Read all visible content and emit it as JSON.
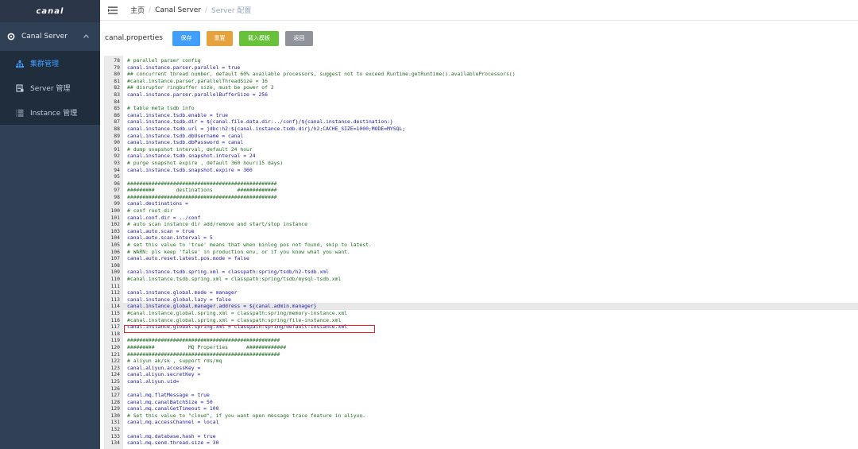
{
  "app": {
    "logo_text": "canal"
  },
  "sidebar": {
    "parent": {
      "label": "Canal Server",
      "icon": "gear-icon"
    },
    "items": [
      {
        "label": "集群管理",
        "icon": "cluster-icon",
        "active": true
      },
      {
        "label": "Server 管理",
        "icon": "server-icon",
        "active": false
      },
      {
        "label": "Instance 管理",
        "icon": "list-icon",
        "active": false
      }
    ]
  },
  "header": {
    "breadcrumb": [
      {
        "label": "主页"
      },
      {
        "label": "Canal Server"
      },
      {
        "label": "Server 配置"
      }
    ]
  },
  "toolbar": {
    "file_name": "canal.properties",
    "save_label": "保存",
    "reset_label": "重置",
    "load_template_label": "载入模板",
    "back_label": "返回"
  },
  "colors": {
    "sidebar_bg": "#304156",
    "primary": "#409eff",
    "warning": "#e6a23c",
    "success": "#67c23a",
    "info": "#909399",
    "highlight_border": "#ee2222"
  },
  "editor": {
    "highlighted_line": 117,
    "active_line": 114,
    "lines": [
      {
        "n": "78",
        "t": "# parallel parser config",
        "c": true
      },
      {
        "n": "79",
        "t": "canal.instance.parser.parallel = true",
        "c": false
      },
      {
        "n": "80",
        "t": "## concurrent thread number, default 60% available processors, suggest not to exceed Runtime.getRuntime().availableProcessors()",
        "c": true
      },
      {
        "n": "81",
        "t": "#canal.instance.parser.parallelThreadSize = 16",
        "c": true
      },
      {
        "n": "82",
        "t": "## disruptor ringbuffer size, must be power of 2",
        "c": true
      },
      {
        "n": "83",
        "t": "canal.instance.parser.parallelBufferSize = 256",
        "c": false
      },
      {
        "n": "84",
        "t": "",
        "c": false
      },
      {
        "n": "85",
        "t": "# table meta tsdb info",
        "c": true
      },
      {
        "n": "86",
        "t": "canal.instance.tsdb.enable = true",
        "c": false
      },
      {
        "n": "87",
        "t": "canal.instance.tsdb.dir = ${canal.file.data.dir:../conf}/${canal.instance.destination:}",
        "c": false
      },
      {
        "n": "88",
        "t": "canal.instance.tsdb.url = jdbc:h2:${canal.instance.tsdb.dir}/h2;CACHE_SIZE=1000;MODE=MYSQL;",
        "c": false
      },
      {
        "n": "89",
        "t": "canal.instance.tsdb.dbUsername = canal",
        "c": false
      },
      {
        "n": "90",
        "t": "canal.instance.tsdb.dbPassword = canal",
        "c": false
      },
      {
        "n": "91",
        "t": "# dump snapshot interval, default 24 hour",
        "c": true
      },
      {
        "n": "92",
        "t": "canal.instance.tsdb.snapshot.interval = 24",
        "c": false
      },
      {
        "n": "93",
        "t": "# purge snapshot expire , default 360 hour(15 days)",
        "c": true
      },
      {
        "n": "94",
        "t": "canal.instance.tsdb.snapshot.expire = 360",
        "c": false
      },
      {
        "n": "95",
        "t": "",
        "c": false
      },
      {
        "n": "96",
        "t": "#################################################",
        "c": true
      },
      {
        "n": "97",
        "t": "#########       destinations        #############",
        "c": true
      },
      {
        "n": "98",
        "t": "#################################################",
        "c": true
      },
      {
        "n": "99",
        "t": "canal.destinations =",
        "c": false
      },
      {
        "n": "100",
        "t": "# conf root dir",
        "c": true
      },
      {
        "n": "101",
        "t": "canal.conf.dir = ../conf",
        "c": false
      },
      {
        "n": "102",
        "t": "# auto scan instance dir add/remove and start/stop instance",
        "c": true
      },
      {
        "n": "103",
        "t": "canal.auto.scan = true",
        "c": false
      },
      {
        "n": "104",
        "t": "canal.auto.scan.interval = 5",
        "c": false
      },
      {
        "n": "105",
        "t": "# set this value to 'true' means that when binlog pos not found, skip to latest.",
        "c": true
      },
      {
        "n": "106",
        "t": "# WARN: pls keep 'false' in production env, or if you know what you want.",
        "c": true
      },
      {
        "n": "107",
        "t": "canal.auto.reset.latest.pos.mode = false",
        "c": false
      },
      {
        "n": "108",
        "t": "",
        "c": false
      },
      {
        "n": "109",
        "t": "canal.instance.tsdb.spring.xml = classpath:spring/tsdb/h2-tsdb.xml",
        "c": false
      },
      {
        "n": "110",
        "t": "#canal.instance.tsdb.spring.xml = classpath:spring/tsdb/mysql-tsdb.xml",
        "c": true
      },
      {
        "n": "111",
        "t": "",
        "c": false
      },
      {
        "n": "112",
        "t": "canal.instance.global.mode = manager",
        "c": false
      },
      {
        "n": "113",
        "t": "canal.instance.global.lazy = false",
        "c": false
      },
      {
        "n": "114",
        "t": "canal.instance.global.manager.address = ${canal.admin.manager}",
        "c": false
      },
      {
        "n": "115",
        "t": "#canal.instance.global.spring.xml = classpath:spring/memory-instance.xml",
        "c": true
      },
      {
        "n": "116",
        "t": "#canal.instance.global.spring.xml = classpath:spring/file-instance.xml",
        "c": true
      },
      {
        "n": "117",
        "t": "canal.instance.global.spring.xml = classpath:spring/default-instance.xml",
        "c": false
      },
      {
        "n": "118",
        "t": "",
        "c": false
      },
      {
        "n": "119",
        "t": "##################################################",
        "c": true
      },
      {
        "n": "120",
        "t": "#########           MQ Properties      #############",
        "c": true
      },
      {
        "n": "121",
        "t": "##################################################",
        "c": true
      },
      {
        "n": "122",
        "t": "# aliyun ak/sk , support rds/mq",
        "c": true
      },
      {
        "n": "123",
        "t": "canal.aliyun.accessKey =",
        "c": false
      },
      {
        "n": "124",
        "t": "canal.aliyun.secretKey =",
        "c": false
      },
      {
        "n": "125",
        "t": "canal.aliyun.uid=",
        "c": false
      },
      {
        "n": "126",
        "t": "",
        "c": false
      },
      {
        "n": "127",
        "t": "canal.mq.flatMessage = true",
        "c": false
      },
      {
        "n": "128",
        "t": "canal.mq.canalBatchSize = 50",
        "c": false
      },
      {
        "n": "129",
        "t": "canal.mq.canalGetTimeout = 100",
        "c": false
      },
      {
        "n": "130",
        "t": "# Set this value to \"cloud\", if you want open message trace feature in aliyun.",
        "c": true
      },
      {
        "n": "131",
        "t": "canal.mq.accessChannel = local",
        "c": false
      },
      {
        "n": "132",
        "t": "",
        "c": false
      },
      {
        "n": "133",
        "t": "canal.mq.database.hash = true",
        "c": false
      },
      {
        "n": "134",
        "t": "canal.mq.send.thread.size = 30",
        "c": false
      }
    ]
  }
}
